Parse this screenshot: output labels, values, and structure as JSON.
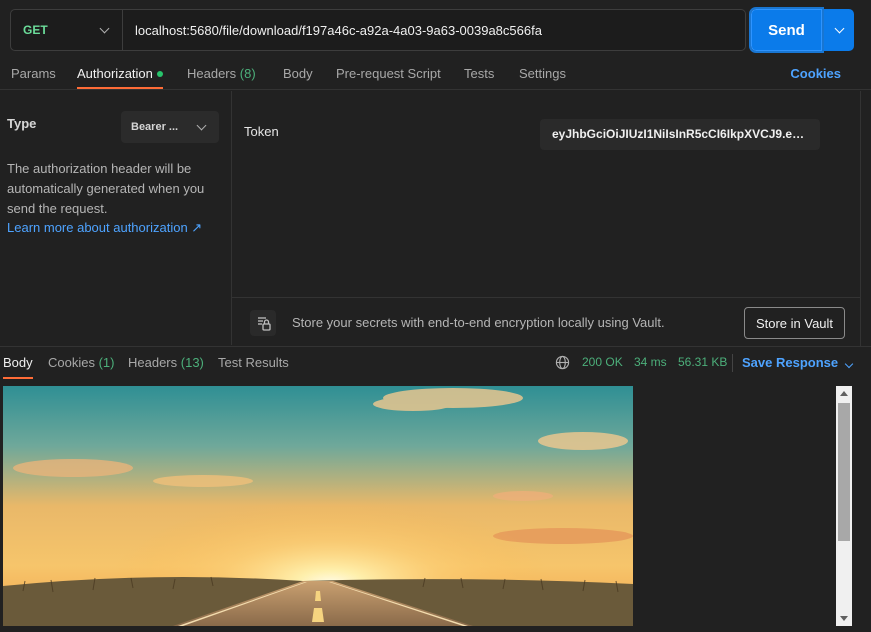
{
  "request": {
    "method": "GET",
    "url": "localhost:5680/file/download/f197a46c-a92a-4a03-9a63-0039a8c566fa",
    "send_label": "Send"
  },
  "tabs": {
    "params": "Params",
    "authorization": "Authorization",
    "headers": "Headers",
    "headers_count": "(8)",
    "body": "Body",
    "pre_request": "Pre-request Script",
    "tests": "Tests",
    "settings": "Settings",
    "cookies": "Cookies"
  },
  "auth": {
    "type_label": "Type",
    "type_value": "Bearer ...",
    "description": "The authorization header will be automatically generated when you send the request.",
    "learn_more": "Learn more about authorization ↗",
    "token_label": "Token",
    "token_value": "eyJhbGciOiJIUzI1NiIsInR5cCI6IkpXVCJ9.eyJ..."
  },
  "vault": {
    "message": "Store your secrets with end-to-end encryption locally using Vault.",
    "button": "Store in Vault"
  },
  "response": {
    "tab_body": "Body",
    "tab_cookies": "Cookies",
    "cookies_count": "(1)",
    "tab_headers": "Headers",
    "headers_count": "(13)",
    "tab_tests": "Test Results",
    "status": "200 OK",
    "time": "34 ms",
    "size": "56.31 KB",
    "save": "Save Response"
  },
  "colors": {
    "accent": "#ff6c37",
    "send": "#0b7bea",
    "link": "#4ea3ff",
    "success": "#4caf7a"
  }
}
